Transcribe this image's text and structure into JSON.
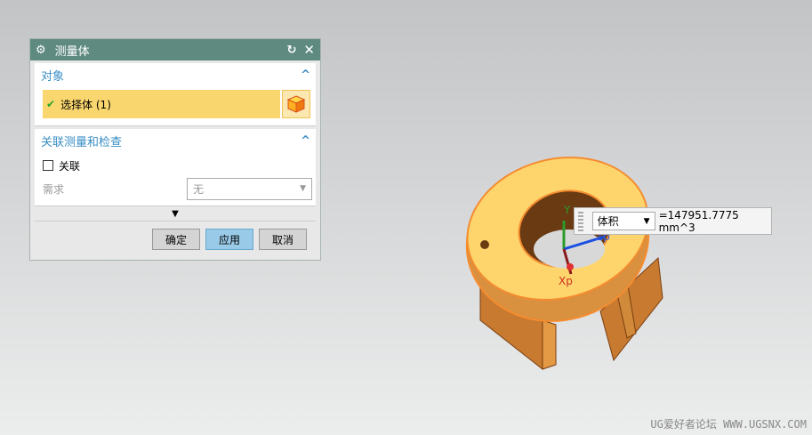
{
  "dialog": {
    "title": "测量体",
    "section_object": {
      "title": "对象",
      "select_label": "选择体 (1)"
    },
    "section_assoc": {
      "title": "关联测量和检查",
      "checkbox_label": "关联",
      "checked": false,
      "requirement_label": "需求",
      "requirement_value": "无"
    },
    "buttons": {
      "ok": "确定",
      "apply": "应用",
      "cancel": "取消"
    }
  },
  "measure": {
    "type": "体积",
    "value": "=147951.7775 mm^3"
  },
  "axes": {
    "x": "Xp",
    "y": "Y",
    "z": "Zp"
  },
  "watermark": "UG爱好者论坛 WWW.UGSNX.COM",
  "colors": {
    "title_bar": "#5e8a80",
    "selection": "#fad66e",
    "accent": "#3a8ec4",
    "part": "#f7b85a"
  }
}
